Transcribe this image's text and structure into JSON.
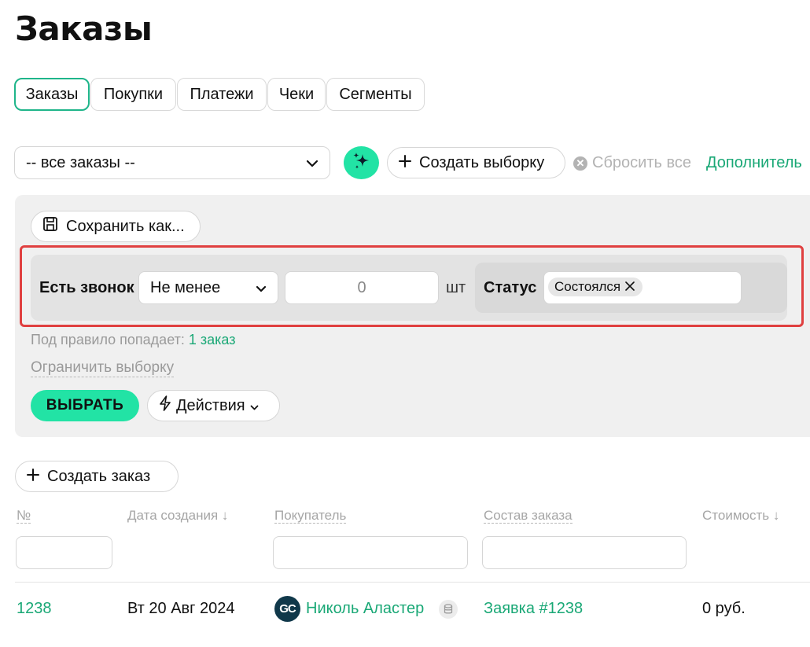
{
  "page_title": "Заказы",
  "tabs": [
    {
      "label": "Заказы",
      "active": true
    },
    {
      "label": "Покупки",
      "active": false
    },
    {
      "label": "Платежи",
      "active": false
    },
    {
      "label": "Чеки",
      "active": false
    },
    {
      "label": "Сегменты",
      "active": false
    }
  ],
  "filter_bar": {
    "segment_select": "-- все заказы --",
    "create_selection": "Создать выборку",
    "reset_all": "Сбросить все",
    "more": "Дополнитель"
  },
  "panel": {
    "save_as": "Сохранить как...",
    "rule": {
      "label": "Есть звонок",
      "condition": "Не менее",
      "value": "0",
      "unit": "шт",
      "status_label": "Статус",
      "status_chip": "Состоялся"
    },
    "hint_prefix": "Под правило попадает:",
    "hint_count": "1 заказ",
    "limit": "Ограничить выборку",
    "choose": "ВЫБРАТЬ",
    "actions": "Действия"
  },
  "create_order": "Создать заказ",
  "table": {
    "headers": {
      "number": "№",
      "date": "Дата создания ↓",
      "buyer": "Покупатель",
      "composition": "Состав заказа",
      "cost": "Стоимость ↓"
    },
    "rows": [
      {
        "number": "1238",
        "date": "Вт 20 Авг 2024",
        "avatar_initials": "GC",
        "buyer": "Николь Аластер",
        "composition": "Заявка #1238",
        "cost": "0 руб."
      }
    ]
  },
  "colors": {
    "accent": "#22e3a5",
    "link": "#1aa876",
    "highlight": "#e04040",
    "avatar_bg": "#10384a"
  },
  "icons": [
    "chevron-down-icon",
    "sparkle-icon",
    "plus-icon",
    "close-circle-icon",
    "floppy-disk-icon",
    "close-icon",
    "lightning-icon",
    "database-icon"
  ]
}
